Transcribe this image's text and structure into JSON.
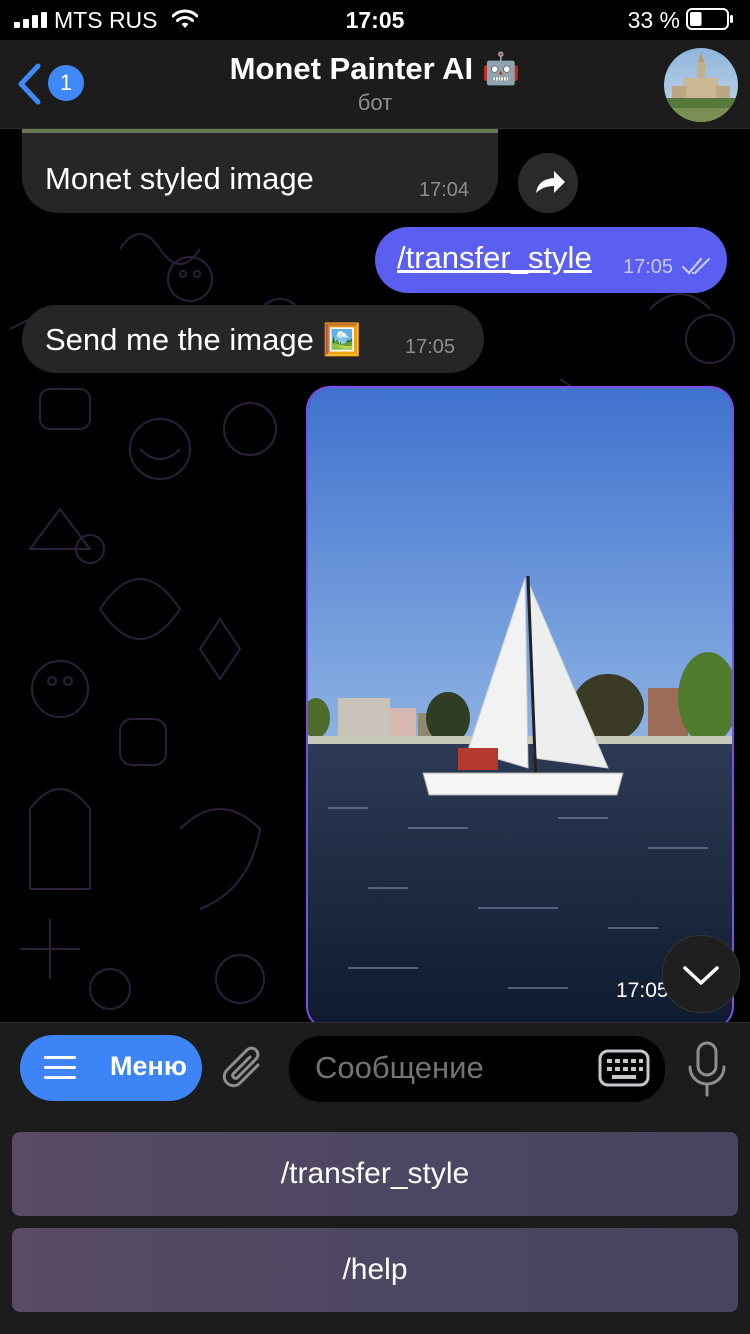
{
  "status_bar": {
    "carrier": "MTS RUS",
    "time": "17:05",
    "battery_percent": "33 %",
    "battery_level": 0.33
  },
  "header": {
    "back_badge": "1",
    "title": "Monet Painter AI 🤖",
    "subtitle": "бот"
  },
  "messages": [
    {
      "direction": "in",
      "text": "Monet styled image",
      "time": "17:04"
    },
    {
      "direction": "out",
      "text": "/transfer_style",
      "time": "17:05",
      "status": "read"
    },
    {
      "direction": "in",
      "text": "Send me the image 🖼️",
      "time": "17:05"
    },
    {
      "direction": "out",
      "type": "photo",
      "time": "17:05"
    }
  ],
  "input_bar": {
    "menu_label": "Меню",
    "placeholder": "Сообщение"
  },
  "keyboard_buttons": [
    "/transfer_style",
    "/help"
  ],
  "colors": {
    "outgoing_bubble": "#5b5ff1",
    "incoming_bubble": "#262628",
    "accent": "#3d84f7"
  }
}
